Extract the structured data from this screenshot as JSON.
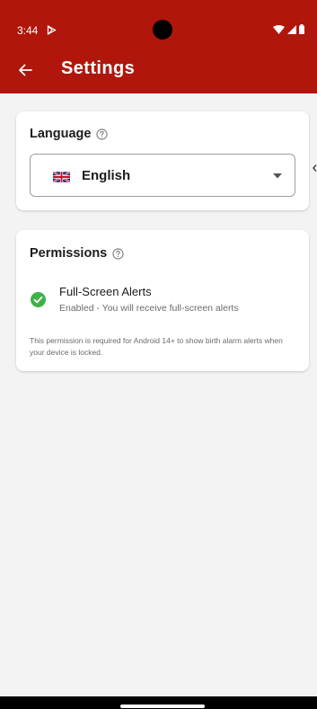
{
  "status_bar": {
    "time": "3:44"
  },
  "app_bar": {
    "title": "Settings",
    "back_icon": "arrow-back-icon"
  },
  "language_card": {
    "heading": "Language",
    "help_icon": "help-circle-icon",
    "selected_flag": "uk-flag-icon",
    "selected_value": "English",
    "caret_icon": "dropdown-caret-icon"
  },
  "permissions_card": {
    "heading": "Permissions",
    "help_icon": "help-circle-icon",
    "items": [
      {
        "status_icon": "check-circle-icon",
        "title": "Full-Screen Alerts",
        "subtitle": "Enabled - You will receive full-screen alerts"
      }
    ],
    "note": "This permission is required for Android 14+ to show birth alarm alerts when your device is locked."
  },
  "colors": {
    "app_bar": "#b0160b",
    "background": "#f3f3f4",
    "success": "#3db346"
  }
}
